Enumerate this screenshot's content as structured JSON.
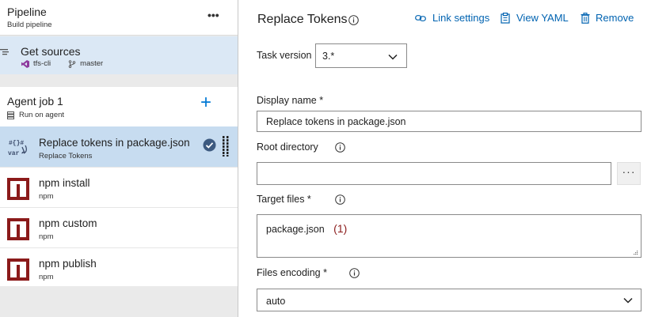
{
  "pipeline": {
    "title": "Pipeline",
    "subtitle": "Build pipeline",
    "more_label": "•••"
  },
  "sources": {
    "title": "Get sources",
    "repo": "tfs-cli",
    "branch": "master"
  },
  "agent_job": {
    "title": "Agent job 1",
    "subtitle": "Run on agent",
    "add_label": "+"
  },
  "tasks": [
    {
      "title": "Replace tokens in package.json",
      "subtitle": "Replace Tokens",
      "icon": "replace-tokens-icon",
      "selected": true
    },
    {
      "title": "npm install",
      "subtitle": "npm",
      "icon": "npm-icon",
      "selected": false
    },
    {
      "title": "npm custom",
      "subtitle": "npm",
      "icon": "npm-icon",
      "selected": false
    },
    {
      "title": "npm publish",
      "subtitle": "npm",
      "icon": "npm-icon",
      "selected": false
    }
  ],
  "detail": {
    "title": "Replace Tokens",
    "toolbar": {
      "link_settings": "Link settings",
      "view_yaml": "View YAML",
      "remove": "Remove"
    },
    "task_version": {
      "label": "Task version",
      "value": "3.*"
    },
    "display_name": {
      "label": "Display name *",
      "value": "Replace tokens in package.json"
    },
    "root_directory": {
      "label": "Root directory",
      "value": "",
      "browse_label": "···"
    },
    "target_files": {
      "label": "Target files *",
      "value": "package.json",
      "annotation": "(1)"
    },
    "files_encoding": {
      "label": "Files encoding *",
      "value": "auto"
    }
  },
  "colors": {
    "accent": "#0078d4",
    "link": "#0063b1",
    "selected_bg": "#c7dcf0",
    "sources_bg": "#dbe8f5",
    "npm_red": "#8b1a1a",
    "annotation": "#8b1c1c"
  }
}
